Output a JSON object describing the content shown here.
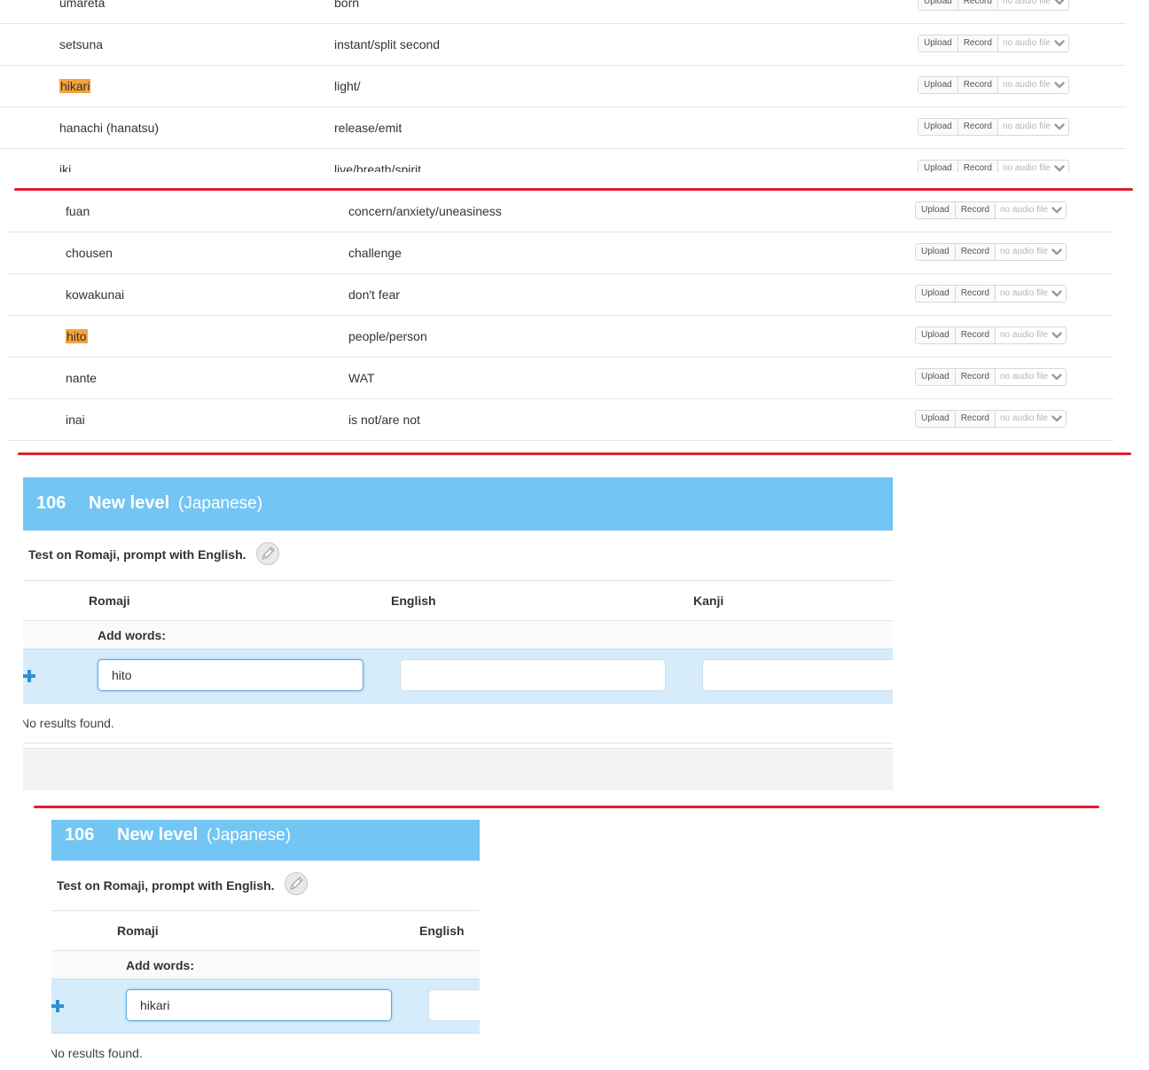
{
  "audio": {
    "upload_label": "Upload",
    "record_label": "Record",
    "no_audio_label": "no audio file"
  },
  "table_top": {
    "rows": [
      {
        "romaji": "umareta",
        "english": "born",
        "highlighted": false
      },
      {
        "romaji": "setsuna",
        "english": "instant/split second",
        "highlighted": false
      },
      {
        "romaji": "hikari",
        "english": "light/",
        "highlighted": true
      },
      {
        "romaji": "hanachi (hanatsu)",
        "english": "release/emit",
        "highlighted": false
      },
      {
        "romaji": "iki",
        "english": "live/breath/spirit",
        "highlighted": false
      }
    ]
  },
  "table_mid": {
    "rows": [
      {
        "romaji": "fuan",
        "english": "concern/anxiety/uneasiness",
        "highlighted": false
      },
      {
        "romaji": "chousen",
        "english": "challenge",
        "highlighted": false
      },
      {
        "romaji": "kowakunai",
        "english": "don't fear",
        "highlighted": false
      },
      {
        "romaji": "hito",
        "english": "people/person",
        "highlighted": true
      },
      {
        "romaji": "nante",
        "english": "WAT",
        "highlighted": false
      },
      {
        "romaji": "inai",
        "english": "is not/are not",
        "highlighted": false
      }
    ]
  },
  "level_1": {
    "number": "106",
    "title": "New level",
    "language": "(Japanese)",
    "description": "Test on Romaji, prompt with English.",
    "columns": [
      "Romaji",
      "English",
      "Kanji"
    ],
    "add_words_label": "Add words:",
    "romaji_value": "hito",
    "english_value": "",
    "kanji_value": "",
    "no_results": "No results found."
  },
  "level_2": {
    "number": "106",
    "title": "New level",
    "language": "(Japanese)",
    "description": "Test on Romaji, prompt with English.",
    "columns": [
      "Romaji",
      "English"
    ],
    "add_words_label": "Add words:",
    "romaji_value": "hikari",
    "english_value": "",
    "no_results": "No results found."
  },
  "colors": {
    "header_blue": "#73c5f3",
    "highlight_orange": "#f6a33b",
    "separator_red": "#e02030",
    "input_row_blue": "#d6ecfa",
    "plus_blue": "#2f8fd3"
  }
}
